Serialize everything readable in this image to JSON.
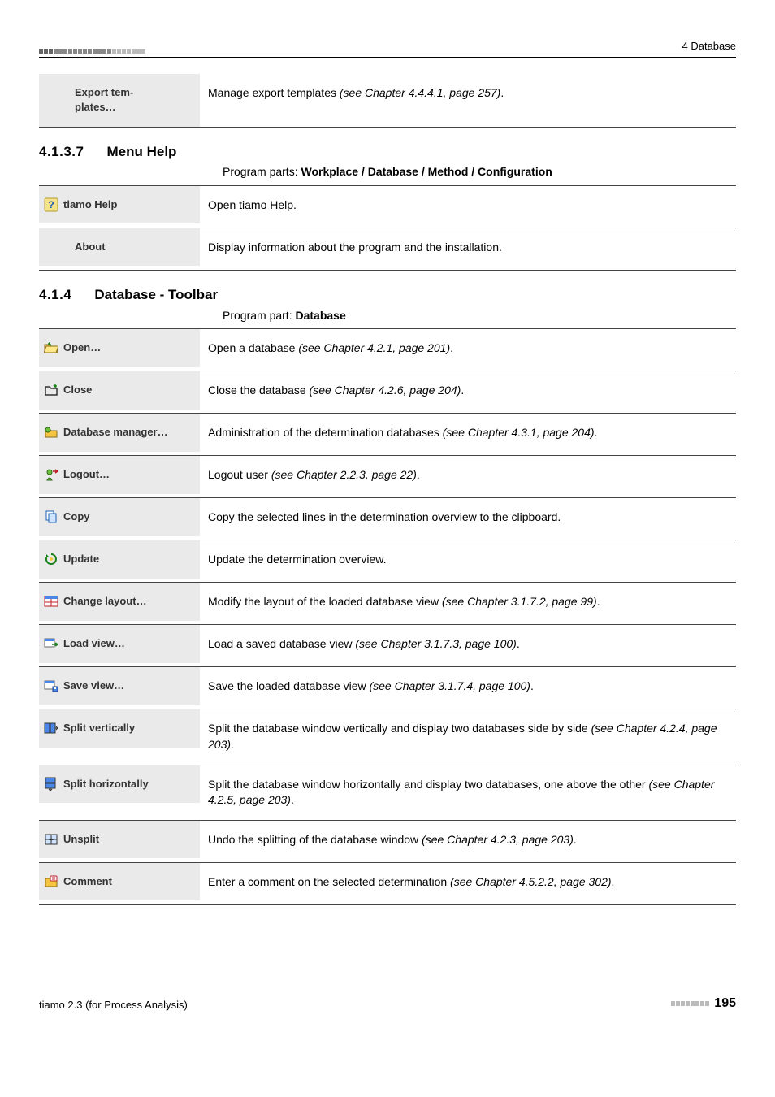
{
  "header": {
    "chapter": "4 Database"
  },
  "exportRow": {
    "label_l1": "Export tem-",
    "label_l2": "plates…",
    "desc_a": "Manage export templates ",
    "desc_i": "(see Chapter 4.4.4.1, page 257)",
    "desc_z": "."
  },
  "sec7": {
    "num": "4.1.3.7",
    "title": "Menu Help",
    "parts_a": "Program parts: ",
    "parts_b": "Workplace / Database / Method / Configuration"
  },
  "helpRows": [
    {
      "icon": "help-icon",
      "label": "tiamo Help",
      "desc": "Open tiamo Help."
    },
    {
      "icon": "",
      "label": "About",
      "desc": "Display information about the program and the installation."
    }
  ],
  "sec414": {
    "num": "4.1.4",
    "title": "Database - Toolbar",
    "parts_a": "Program part: ",
    "parts_b": "Database"
  },
  "toolbar": [
    {
      "icon": "open-icon",
      "label": "Open…",
      "desc_a": "Open a database ",
      "desc_i": "(see Chapter 4.2.1, page 201)",
      "desc_z": "."
    },
    {
      "icon": "close-icon",
      "label": "Close",
      "desc_a": "Close the database ",
      "desc_i": "(see Chapter 4.2.6, page 204)",
      "desc_z": "."
    },
    {
      "icon": "dbmanager-icon",
      "label": "Database manager…",
      "desc_a": "Administration of the determination databases ",
      "desc_i": "(see Chapter 4.3.1, page 204)",
      "desc_z": "."
    },
    {
      "icon": "logout-icon",
      "label": "Logout…",
      "desc_a": "Logout user ",
      "desc_i": "(see Chapter 2.2.3, page 22)",
      "desc_z": "."
    },
    {
      "icon": "copy-icon",
      "label": "Copy",
      "desc_a": "Copy the selected lines in the determination overview to the clipboard.",
      "desc_i": "",
      "desc_z": ""
    },
    {
      "icon": "update-icon",
      "label": "Update",
      "desc_a": "Update the determination overview.",
      "desc_i": "",
      "desc_z": ""
    },
    {
      "icon": "changelayout-icon",
      "label": "Change layout…",
      "desc_a": "Modify the layout of the loaded database view ",
      "desc_i": "(see Chapter 3.1.7.2, page 99)",
      "desc_z": "."
    },
    {
      "icon": "loadview-icon",
      "label": "Load view…",
      "desc_a": "Load a saved database view ",
      "desc_i": "(see Chapter 3.1.7.3, page 100)",
      "desc_z": "."
    },
    {
      "icon": "saveview-icon",
      "label": "Save view…",
      "desc_a": "Save the loaded database view ",
      "desc_i": "(see Chapter 3.1.7.4, page 100)",
      "desc_z": "."
    },
    {
      "icon": "splitv-icon",
      "label": "Split vertically",
      "desc_a": "Split the database window vertically and display two databases side by side ",
      "desc_i": "(see Chapter 4.2.4, page 203)",
      "desc_z": "."
    },
    {
      "icon": "splith-icon",
      "label": "Split horizontally",
      "desc_a": "Split the database window horizontally and display two databases, one above the other ",
      "desc_i": "(see Chapter 4.2.5, page 203)",
      "desc_z": "."
    },
    {
      "icon": "unsplit-icon",
      "label": "Unsplit",
      "desc_a": "Undo the splitting of the database window ",
      "desc_i": "(see Chapter 4.2.3, page 203)",
      "desc_z": "."
    },
    {
      "icon": "comment-icon",
      "label": "Comment",
      "desc_a": "Enter a comment on the selected determination ",
      "desc_i": "(see Chapter 4.5.2.2, page 302)",
      "desc_z": "."
    }
  ],
  "footer": {
    "left": "tiamo 2.3 (for Process Analysis)",
    "page": "195"
  },
  "icons": {
    "help-icon": "<svg viewBox='0 0 18 18'><rect x='1' y='1' width='16' height='16' rx='2' fill='#f5e38a' stroke='#b89b2e'/><text x='9' y='13' text-anchor='middle' font-size='12' font-weight='bold' fill='#1a5fb4'>?</text></svg>",
    "open-icon": "<svg viewBox='0 0 18 18'><path d='M1 5 h6 l2 2 h8 v8 h-16 z' fill='#f5c542' stroke='#8a6d1a'/><path d='M3 7 h15 l-3 8 h-15 z' fill='#ffe88a' stroke='#8a6d1a'/><path d='M6 3 l3 3 M6 3 l0 2 M6 3 l2 0' stroke='#1a7f1a' stroke-width='1.5' fill='none'/></svg>",
    "close-icon": "<svg viewBox='0 0 18 18'><path d='M2 5 h5 l2 2 h7 v8 h-14 z' fill='none' stroke='#333' stroke-width='1.5'/><path d='M12 3 l3 3 M15 3 l0 2 M15 3 l-2 0' stroke='#1a7f1a' stroke-width='1.5' fill='none'/></svg>",
    "dbmanager-icon": "<svg viewBox='0 0 18 18'><path d='M2 5 h5 l2 2 h7 v8 h-14 z' fill='#f5c542' stroke='#8a6d1a'/><circle cx='5' cy='6' r='3' fill='#6fbf3f' stroke='#2d6b15'/></svg>",
    "logout-icon": "<svg viewBox='0 0 18 18'><circle cx='7' cy='6' r='3' fill='#6fbf3f' stroke='#2d6b15'/><path d='M4 16 q3 -6 6 0 z' fill='#6fbf3f' stroke='#2d6b15'/><path d='M11 5 h5 M14 3 l3 2 l-3 2' stroke='#c01c28' stroke-width='1.5' fill='none'/></svg>",
    "copy-icon": "<svg viewBox='0 0 18 18'><rect x='3' y='2' width='9' height='11' fill='#fff' stroke='#1a5fb4'/><rect x='6' y='5' width='9' height='11' fill='#cfe3ff' stroke='#1a5fb4'/></svg>",
    "update-icon": "<svg viewBox='0 0 18 18'><path d='M9 3 a6 6 0 1 1 -5.7 4' fill='none' stroke='#1a7f1a' stroke-width='2'/><path d='M3 3 l0 4 l4 0' fill='#1a7f1a'/><circle cx='9' cy='9' r='2' fill='#f5c542'/></svg>",
    "changelayout-icon": "<svg viewBox='0 0 18 18'><rect x='1' y='3' width='16' height='12' fill='#fff' stroke='#c01c28'/><rect x='1' y='3' width='16' height='3' fill='#4a86e8'/><line x1='9' y1='6' x2='9' y2='15' stroke='#c01c28'/><line x1='1' y1='10' x2='17' y2='10' stroke='#c01c28'/></svg>",
    "loadview-icon": "<svg viewBox='0 0 18 18'><rect x='1' y='3' width='12' height='10' fill='#fff' stroke='#666'/><rect x='1' y='3' width='12' height='3' fill='#4a86e8'/><path d='M10 10 h6 M14 8 l3 2 l-3 2' stroke='#1a7f1a' stroke-width='1.5' fill='none'/></svg>",
    "saveview-icon": "<svg viewBox='0 0 18 18'><rect x='1' y='3' width='12' height='10' fill='#fff' stroke='#666'/><rect x='1' y='3' width='12' height='3' fill='#4a86e8'/><rect x='11' y='10' width='6' height='6' fill='#4a86e8' stroke='#1a3f8a'/><rect x='13' y='10' width='2' height='3' fill='#fff'/></svg>",
    "splitv-icon": "<svg viewBox='0 0 18 18'><rect x='1' y='3' width='6' height='12' fill='#4a86e8' stroke='#333'/><rect x='8' y='3' width='6' height='12' fill='#4a86e8' stroke='#333'/><path d='M14 9 l3 0 M15 7 l2 2 l-2 2' stroke='#333' fill='none'/></svg>",
    "splith-icon": "<svg viewBox='0 0 18 18'><rect x='2' y='1' width='12' height='6' fill='#4a86e8' stroke='#333'/><rect x='2' y='8' width='12' height='6' fill='#4a86e8' stroke='#333'/><path d='M8 14 l0 3 M6 15 l2 2 l2 -2' stroke='#333' fill='none'/></svg>",
    "unsplit-icon": "<svg viewBox='0 0 18 18'><rect x='2' y='3' width='14' height='12' fill='#cfe3ff' stroke='#333'/><line x1='9' y1='3' x2='9' y2='15' stroke='#333'/><line x1='2' y1='9' x2='16' y2='9' stroke='#333'/><text x='9' y='13' text-anchor='middle' font-size='10' fill='#333'>+</text></svg>",
    "comment-icon": "<svg viewBox='0 0 18 18'><path d='M2 5 h5 l2 2 h7 v8 h-14 z' fill='#f5c542' stroke='#8a6d1a'/><rect x='8' y='2' width='8' height='6' rx='1' fill='#fff' stroke='#c01c28'/><line x1='10' y1='4' x2='14' y2='4' stroke='#c01c28'/><line x1='10' y1='6' x2='14' y2='6' stroke='#c01c28'/></svg>"
  }
}
